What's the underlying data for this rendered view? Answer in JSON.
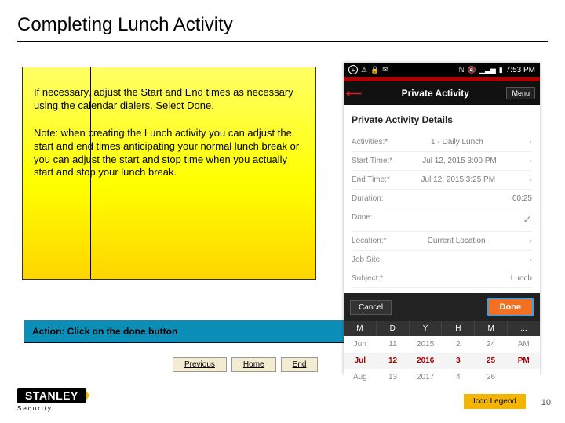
{
  "title": "Completing Lunch Activity",
  "note": {
    "p1": "If necessary, adjust the Start and End times as necessary using the calendar dialers. Select Done.",
    "p2": "Note: when creating the Lunch activity you can adjust the start and end times anticipating your normal lunch break or you can adjust the start and stop time when you actually start and stop your lunch break."
  },
  "action_text": "Action:  Click on the done button",
  "nav": {
    "previous": "Previous",
    "home": "Home",
    "end": "End"
  },
  "footer": {
    "logo_main": "STANLEY",
    "logo_sub": "Security",
    "icon_legend": "Icon Legend",
    "page_num": "10"
  },
  "phone": {
    "status": {
      "clock": "7:53 PM"
    },
    "appbar": {
      "title": "Private Activity",
      "menu": "Menu"
    },
    "details_header": "Private Activity Details",
    "rows": {
      "activities": {
        "label": "Activities:*",
        "value": "1 - Daily Lunch"
      },
      "start": {
        "label": "Start Time:*",
        "value": "Jul 12, 2015 3:00 PM"
      },
      "end": {
        "label": "End Time:*",
        "value": "Jul 12, 2015 3:25 PM"
      },
      "duration": {
        "label": "Duration:",
        "value": "00:25"
      },
      "done": {
        "label": "Done:",
        "value": ""
      },
      "location": {
        "label": "Location:*",
        "value": "Current Location"
      },
      "jobsite": {
        "label": "Job Site:",
        "value": ""
      },
      "subject": {
        "label": "Subject:*",
        "value": "Lunch"
      }
    },
    "buttons": {
      "cancel": "Cancel",
      "done": "Done"
    },
    "dial": {
      "headers": [
        "M",
        "D",
        "Y",
        "H",
        "M",
        "..."
      ],
      "r1": [
        "Jun",
        "11",
        "2015",
        "2",
        "24",
        "AM"
      ],
      "r2": [
        "Jul",
        "12",
        "2016",
        "3",
        "25",
        "PM"
      ],
      "r3": [
        "Aug",
        "13",
        "2017",
        "4",
        "26",
        ""
      ]
    }
  }
}
